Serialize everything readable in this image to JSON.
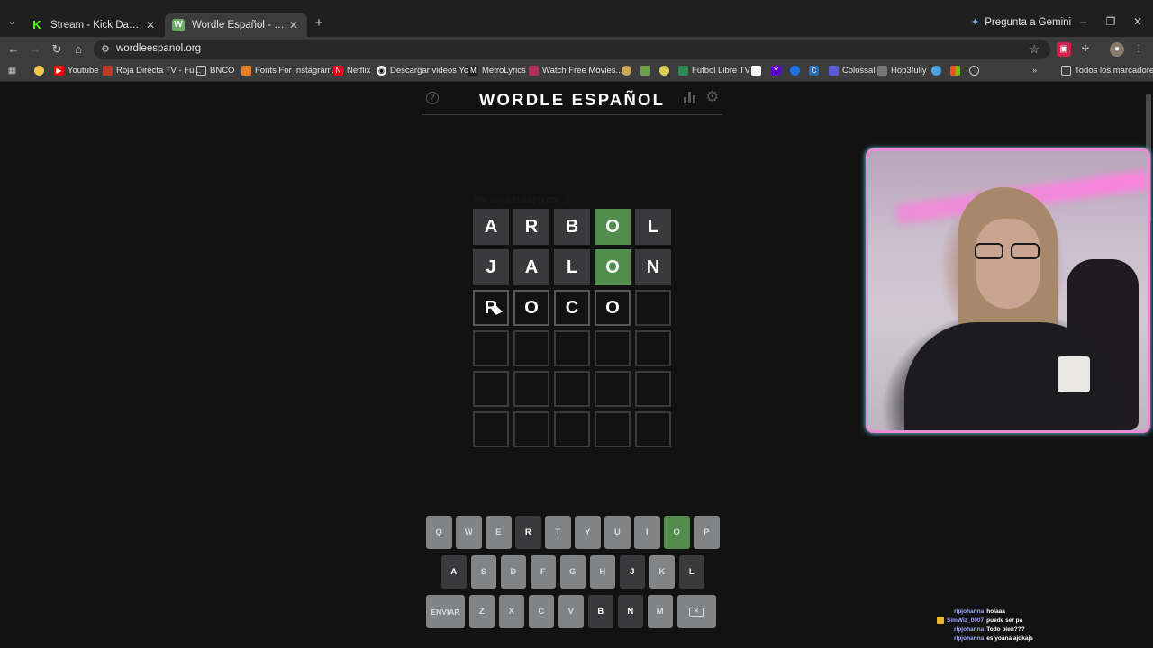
{
  "browser": {
    "tabs": [
      {
        "label": "Stream - Kick Dashboard",
        "active": false
      },
      {
        "label": "Wordle Español - Wordle ilimitado",
        "active": true
      }
    ],
    "gemini_label": "Pregunta a Gemini",
    "url": "wordleespanol.org",
    "bookmarks": [
      "Youtube",
      "Roja Directa TV - Fu...",
      "BNCO",
      "Fonts For Instagram...",
      "Netflix",
      "Descargar videos Yo...",
      "MetroLyrics",
      "Watch Free Movies...",
      "Fútbol Libre TV",
      "Colossal",
      "Hop3fully"
    ],
    "all_bookmarks": "Todos los marcadores"
  },
  "game": {
    "title": "WORDLE ESPAÑOL",
    "byline": "Por arnoldodiaz (t.co/...)",
    "board": [
      [
        {
          "l": "A",
          "s": "absent"
        },
        {
          "l": "R",
          "s": "absent"
        },
        {
          "l": "B",
          "s": "absent"
        },
        {
          "l": "O",
          "s": "correct"
        },
        {
          "l": "L",
          "s": "absent"
        }
      ],
      [
        {
          "l": "J",
          "s": "absent"
        },
        {
          "l": "A",
          "s": "absent"
        },
        {
          "l": "L",
          "s": "absent"
        },
        {
          "l": "O",
          "s": "correct"
        },
        {
          "l": "N",
          "s": "absent"
        }
      ],
      [
        {
          "l": "R",
          "s": "filled"
        },
        {
          "l": "O",
          "s": "filled"
        },
        {
          "l": "C",
          "s": "filled"
        },
        {
          "l": "O",
          "s": "filled"
        },
        {
          "l": "",
          "s": "empty"
        }
      ],
      [
        {
          "l": "",
          "s": "empty"
        },
        {
          "l": "",
          "s": "empty"
        },
        {
          "l": "",
          "s": "empty"
        },
        {
          "l": "",
          "s": "empty"
        },
        {
          "l": "",
          "s": "empty"
        }
      ],
      [
        {
          "l": "",
          "s": "empty"
        },
        {
          "l": "",
          "s": "empty"
        },
        {
          "l": "",
          "s": "empty"
        },
        {
          "l": "",
          "s": "empty"
        },
        {
          "l": "",
          "s": "empty"
        }
      ],
      [
        {
          "l": "",
          "s": "empty"
        },
        {
          "l": "",
          "s": "empty"
        },
        {
          "l": "",
          "s": "empty"
        },
        {
          "l": "",
          "s": "empty"
        },
        {
          "l": "",
          "s": "empty"
        }
      ]
    ],
    "keyboard": [
      [
        {
          "k": "Q"
        },
        {
          "k": "W"
        },
        {
          "k": "E"
        },
        {
          "k": "R",
          "s": "absent"
        },
        {
          "k": "T"
        },
        {
          "k": "Y"
        },
        {
          "k": "U"
        },
        {
          "k": "I"
        },
        {
          "k": "O",
          "s": "correct"
        },
        {
          "k": "P"
        }
      ],
      [
        {
          "k": "A",
          "s": "absent"
        },
        {
          "k": "S"
        },
        {
          "k": "D"
        },
        {
          "k": "F"
        },
        {
          "k": "G"
        },
        {
          "k": "H"
        },
        {
          "k": "J",
          "s": "absent"
        },
        {
          "k": "K"
        },
        {
          "k": "L",
          "s": "absent"
        }
      ],
      [
        {
          "k": "ENVIAR",
          "wide": true
        },
        {
          "k": "Z"
        },
        {
          "k": "X"
        },
        {
          "k": "C"
        },
        {
          "k": "V"
        },
        {
          "k": "B",
          "s": "absent"
        },
        {
          "k": "N",
          "s": "absent"
        },
        {
          "k": "M"
        },
        {
          "k": "⌫",
          "wide": true,
          "backspace": true
        }
      ]
    ]
  },
  "chat": [
    {
      "user": "ripjohanna",
      "msg": "holaaa",
      "badge": false
    },
    {
      "user": "SimWiz_0007",
      "msg": "puede ser pa",
      "badge": true
    },
    {
      "user": "ripjohanna",
      "msg": "Todo bien???",
      "badge": false
    },
    {
      "user": "ripjohanna",
      "msg": "es yoana ajdkajs",
      "badge": false
    }
  ]
}
